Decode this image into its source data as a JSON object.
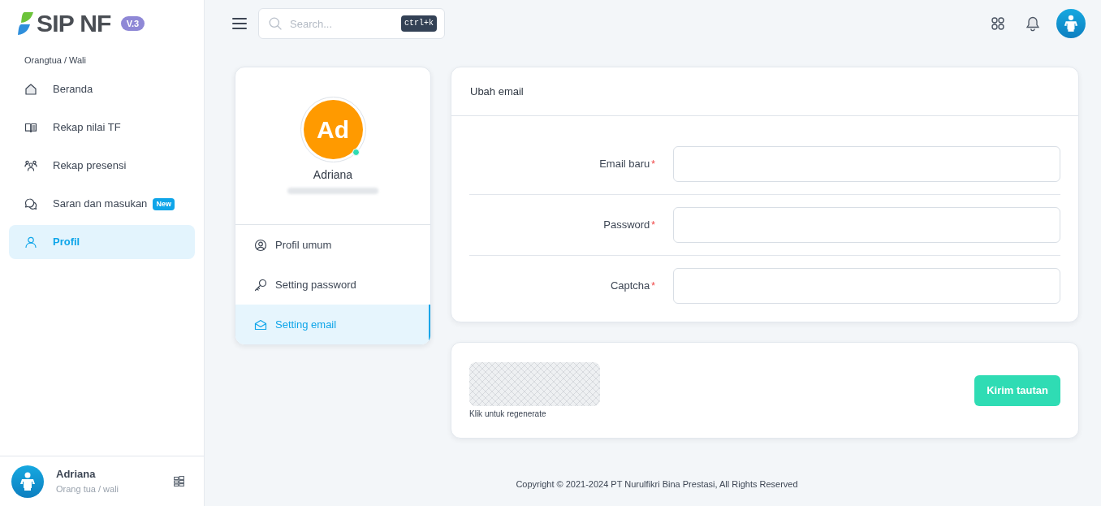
{
  "sidebar": {
    "logo_text": "SIP NF",
    "version": "V.3",
    "section_title": "Orangtua / Wali",
    "items": [
      {
        "label": "Beranda",
        "selected": false
      },
      {
        "label": "Rekap nilai TF",
        "selected": false
      },
      {
        "label": "Rekap presensi",
        "selected": false
      },
      {
        "label": "Saran dan masukan",
        "badge": "New",
        "selected": false
      },
      {
        "label": "Profil",
        "selected": true
      }
    ],
    "user": {
      "name": "Adriana",
      "role": "Orang tua / wali"
    }
  },
  "header": {
    "search": {
      "placeholder": "Search...",
      "shortcut": "ctrl+k"
    }
  },
  "profile_card": {
    "initials": "Ad",
    "online": true,
    "name": "Adriana",
    "menu": [
      {
        "label": "Profil umum",
        "selected": false
      },
      {
        "label": "Setting password",
        "selected": false
      },
      {
        "label": "Setting email",
        "selected": true
      }
    ]
  },
  "email_form": {
    "title": "Ubah email",
    "fields": [
      {
        "label": "Email baru",
        "required_mark": "*"
      },
      {
        "label": "Password",
        "required_mark": "*"
      },
      {
        "label": "Captcha",
        "required_mark": "*"
      }
    ]
  },
  "captcha_card": {
    "hint": "Klik untuk regenerate",
    "submit_button": "Kirim tautan"
  },
  "footer": "Copyright © 2021-2024 PT Nurulfikri Bina Prestasi, All Rights Reserved"
}
